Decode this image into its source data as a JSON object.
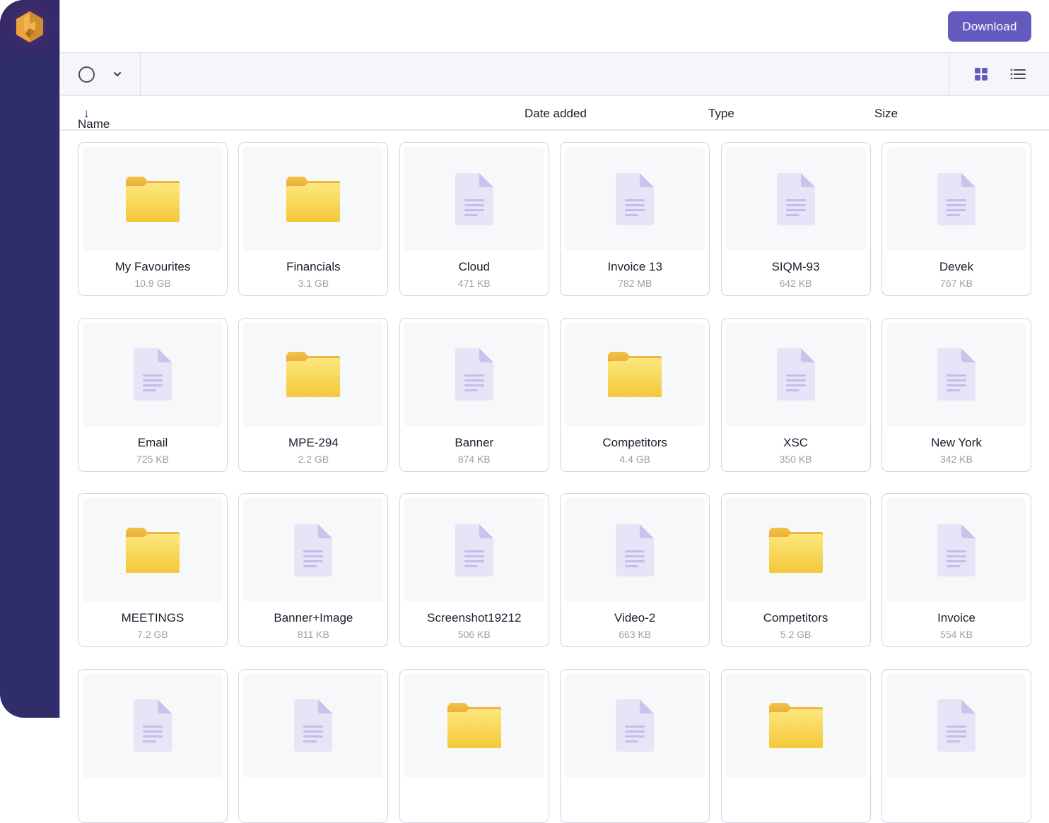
{
  "app": {
    "logo_icon": "cube-logo-icon",
    "accent_color": "#625bbd",
    "sidebar_color": "#302d6b"
  },
  "header": {
    "download_label": "Download"
  },
  "toolbar": {
    "select_icon": "circle-select-icon",
    "dropdown_icon": "chevron-down-icon",
    "grid_view_icon": "grid-view-icon",
    "list_view_icon": "list-view-icon",
    "active_view": "grid"
  },
  "columns": {
    "name": "Name",
    "name_sort_icon": "↓",
    "date_added": "Date added",
    "type": "Type",
    "size": "Size"
  },
  "files": [
    {
      "name": "My Favourites",
      "size": "10.9 GB",
      "kind": "folder"
    },
    {
      "name": "Financials",
      "size": "3.1 GB",
      "kind": "folder"
    },
    {
      "name": "Cloud",
      "size": "471 KB",
      "kind": "file"
    },
    {
      "name": "Invoice 13",
      "size": "782 MB",
      "kind": "file"
    },
    {
      "name": "SIQM-93",
      "size": "642 KB",
      "kind": "file"
    },
    {
      "name": "Devek",
      "size": "767 KB",
      "kind": "file"
    },
    {
      "name": "Email",
      "size": "725 KB",
      "kind": "file"
    },
    {
      "name": "MPE-294",
      "size": "2.2 GB",
      "kind": "folder"
    },
    {
      "name": "Banner",
      "size": "874 KB",
      "kind": "file"
    },
    {
      "name": "Competitors",
      "size": "4.4 GB",
      "kind": "folder"
    },
    {
      "name": "XSC",
      "size": "350 KB",
      "kind": "file"
    },
    {
      "name": "New York",
      "size": "342 KB",
      "kind": "file"
    },
    {
      "name": "MEETINGS",
      "size": "7.2 GB",
      "kind": "folder"
    },
    {
      "name": "Banner+Image",
      "size": "811 KB",
      "kind": "file"
    },
    {
      "name": "Screenshot19212",
      "size": "506 KB",
      "kind": "file"
    },
    {
      "name": "Video-2",
      "size": "663 KB",
      "kind": "file"
    },
    {
      "name": "Competitors",
      "size": "5.2 GB",
      "kind": "folder"
    },
    {
      "name": "Invoice",
      "size": "554 KB",
      "kind": "file"
    },
    {
      "name": "",
      "size": "",
      "kind": "file"
    },
    {
      "name": "",
      "size": "",
      "kind": "file"
    },
    {
      "name": "",
      "size": "",
      "kind": "folder"
    },
    {
      "name": "",
      "size": "",
      "kind": "file"
    },
    {
      "name": "",
      "size": "",
      "kind": "folder"
    },
    {
      "name": "",
      "size": "",
      "kind": "file"
    }
  ]
}
